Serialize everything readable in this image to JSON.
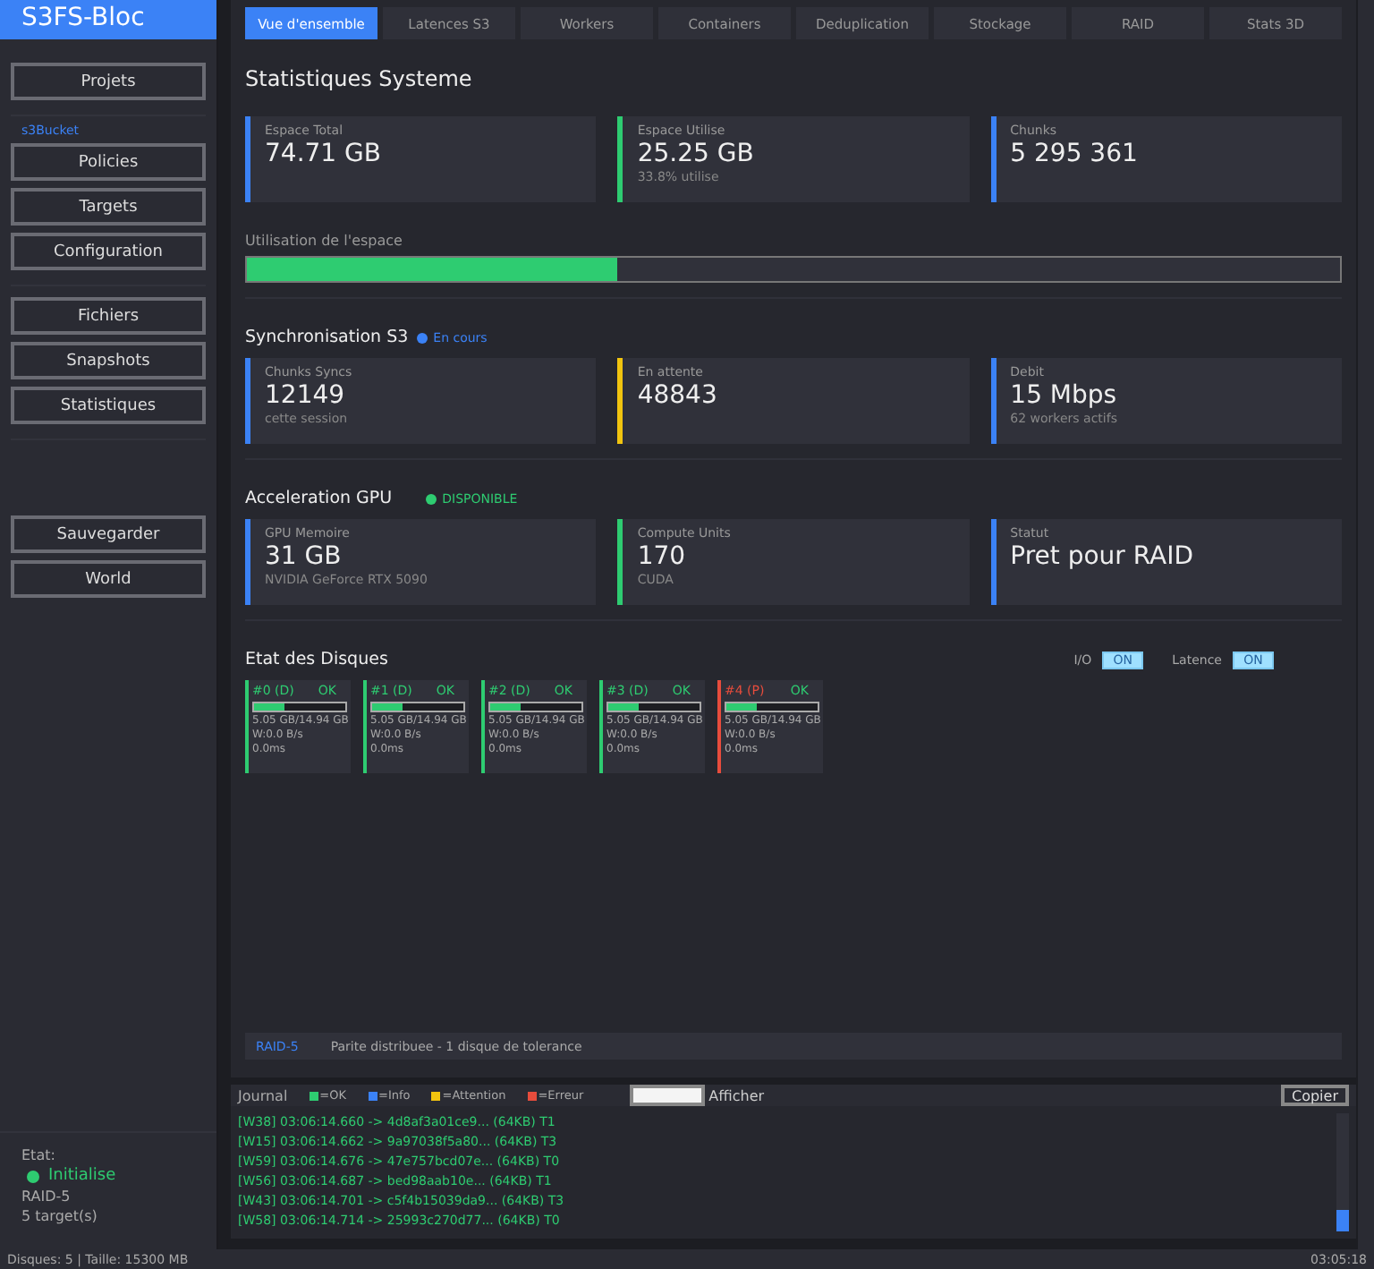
{
  "app": {
    "title": "S3FS-Bloc"
  },
  "sidebar": {
    "groups": [
      {
        "items": [
          {
            "label": "Projets"
          }
        ]
      },
      {
        "caption": "s3Bucket",
        "items": [
          {
            "label": "Policies"
          },
          {
            "label": "Targets"
          },
          {
            "label": "Configuration"
          }
        ]
      },
      {
        "items": [
          {
            "label": "Fichiers"
          },
          {
            "label": "Snapshots"
          },
          {
            "label": "Statistiques"
          }
        ]
      },
      {
        "items": [
          {
            "label": "Sauvegarder"
          },
          {
            "label": "World"
          }
        ]
      }
    ],
    "status": {
      "caption": "Etat:",
      "state": "Initialise",
      "color": "#2ecc71",
      "mode": "RAID-5",
      "targets": "5 target(s)"
    }
  },
  "tabs": [
    {
      "label": "Vue d'ensemble",
      "selected": true
    },
    {
      "label": "Latences S3",
      "selected": false
    },
    {
      "label": "Workers",
      "selected": false
    },
    {
      "label": "Containers",
      "selected": false
    },
    {
      "label": "Deduplication",
      "selected": false
    },
    {
      "label": "Stockage",
      "selected": false
    },
    {
      "label": "RAID",
      "selected": false
    },
    {
      "label": "Stats 3D",
      "selected": false
    }
  ],
  "title": "Statistiques Systeme",
  "space_cards": [
    {
      "label": "Espace Total",
      "value": "74.71 GB",
      "color": "#3b82f6"
    },
    {
      "label": "Espace Utilise",
      "value": "25.25 GB",
      "sub": "33.8% utilise",
      "color": "#2ecc71"
    },
    {
      "label": "Chunks",
      "value": "5 295 361",
      "color": "#3b82f6"
    }
  ],
  "usage": {
    "label": "Utilisation de l'espace",
    "level": 0.338
  },
  "sync": {
    "title": "Synchronisation S3",
    "badge": "En cours",
    "color": "#3b82f6",
    "cards": [
      {
        "label": "Chunks Syncs",
        "value": "12149",
        "sub": "cette session",
        "color": "#3b82f6"
      },
      {
        "label": "En attente",
        "value": "48843",
        "color": "#f1c40f"
      },
      {
        "label": "Debit",
        "value": "15 Mbps",
        "sub": "62 workers actifs",
        "color": "#3b82f6"
      }
    ]
  },
  "gpu": {
    "title": "Acceleration GPU",
    "badge": "DISPONIBLE",
    "color": "#2ecc71",
    "cards": [
      {
        "label": "GPU Memoire",
        "value": "31 GB",
        "sub": "NVIDIA GeForce RTX 5090",
        "color": "#3b82f6"
      },
      {
        "label": "Compute Units",
        "value": "170",
        "sub": "CUDA",
        "color": "#2ecc71"
      },
      {
        "label": "Statut",
        "value": "Pret pour RAID",
        "color": "#3b82f6"
      }
    ]
  },
  "disks": {
    "title": "Etat des Disques",
    "toggles": [
      {
        "label": "I/O",
        "value": "ON",
        "on": true
      },
      {
        "label": "Latence",
        "value": "ON",
        "on": true
      }
    ],
    "items": [
      {
        "name": "#0 (D)",
        "status": "OK",
        "level": 0.34,
        "size": "5.05 GB/14.94 GB",
        "rate": "W:0.0 B/s",
        "latency": "0.0ms",
        "color": "#2ecc71"
      },
      {
        "name": "#1 (D)",
        "status": "OK",
        "level": 0.34,
        "size": "5.05 GB/14.94 GB",
        "rate": "W:0.0 B/s",
        "latency": "0.0ms",
        "color": "#2ecc71"
      },
      {
        "name": "#2 (D)",
        "status": "OK",
        "level": 0.34,
        "size": "5.05 GB/14.94 GB",
        "rate": "W:0.0 B/s",
        "latency": "0.0ms",
        "color": "#2ecc71"
      },
      {
        "name": "#3 (D)",
        "status": "OK",
        "level": 0.34,
        "size": "5.05 GB/14.94 GB",
        "rate": "W:0.0 B/s",
        "latency": "0.0ms",
        "color": "#2ecc71"
      },
      {
        "name": "#4 (P)",
        "status": "OK",
        "level": 0.34,
        "size": "5.05 GB/14.94 GB",
        "rate": "W:0.0 B/s",
        "latency": "0.0ms",
        "color": "#e74c3c"
      }
    ]
  },
  "raid": {
    "mode": "RAID-5",
    "description": "Parite distribuee - 1 disque de tolerance"
  },
  "journal": {
    "title": "Journal",
    "legend": [
      {
        "label": "=OK",
        "color": "#2ecc71"
      },
      {
        "label": "=Info",
        "color": "#3b82f6"
      },
      {
        "label": "=Attention",
        "color": "#f1c40f"
      },
      {
        "label": "=Erreur",
        "color": "#e74c3c"
      }
    ],
    "show_label": "Afficher",
    "copy": "Copier",
    "lines": [
      {
        "text": "[W38] 03:06:14.660 -> 4d8af3a01ce9... (64KB) T1",
        "color": "#2ecc71"
      },
      {
        "text": "[W15] 03:06:14.662 -> 9a97038f5a80... (64KB) T3",
        "color": "#2ecc71"
      },
      {
        "text": "[W59] 03:06:14.676 -> 47e757bcd07e... (64KB) T0",
        "color": "#2ecc71"
      },
      {
        "text": "[W56] 03:06:14.687 -> bed98aab10e... (64KB) T1",
        "color": "#2ecc71"
      },
      {
        "text": "[W43] 03:06:14.701 -> c5f4b15039da9... (64KB) T3",
        "color": "#2ecc71"
      },
      {
        "text": "[W58] 03:06:14.714 -> 25993c270d77... (64KB) T0",
        "color": "#2ecc71"
      }
    ]
  },
  "status_bar": {
    "left": "Disques: 5 | Taille: 15300 MB",
    "right": "03:05:18"
  }
}
